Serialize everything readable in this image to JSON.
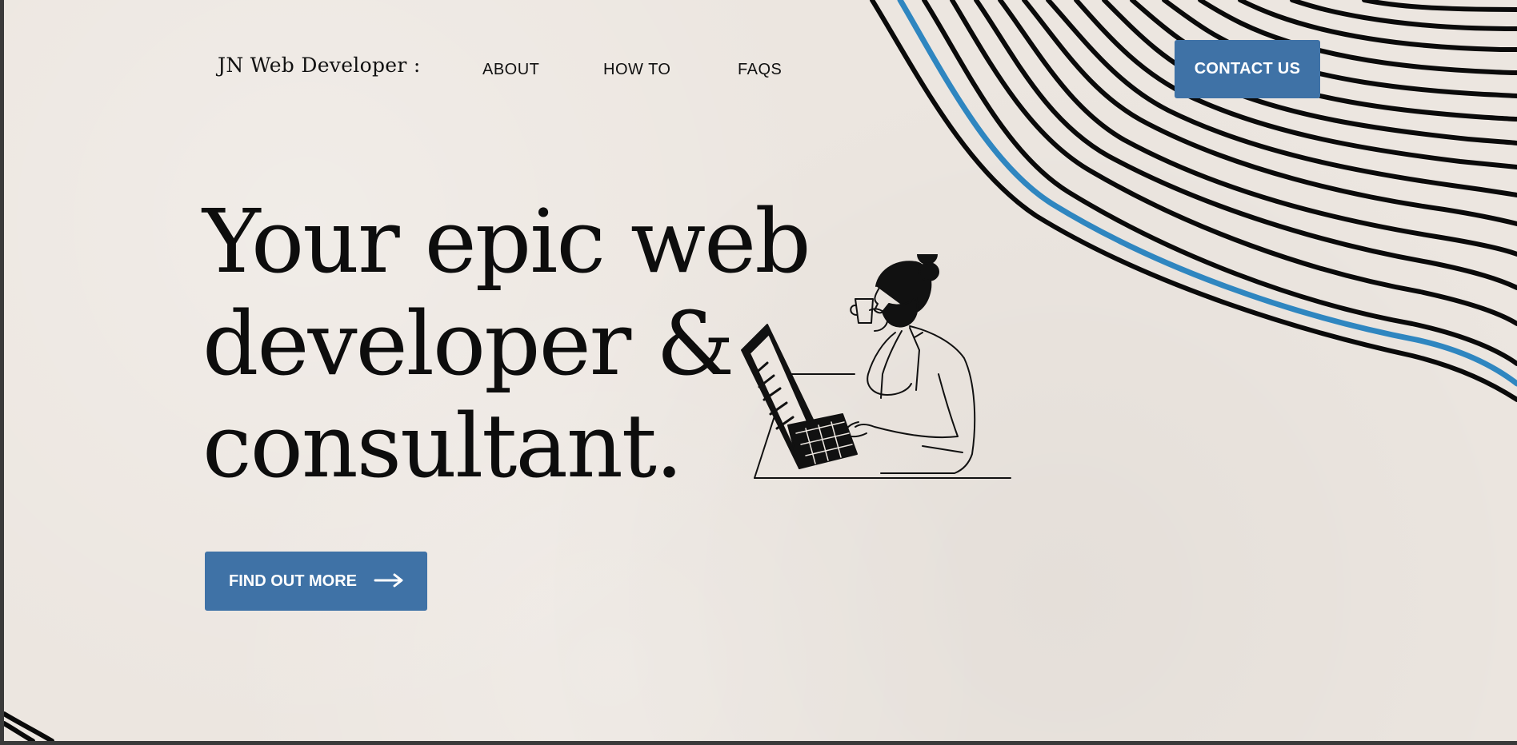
{
  "brand": {
    "logo_text": "JN Web Developer :"
  },
  "nav": {
    "items": [
      {
        "label": "ABOUT"
      },
      {
        "label": "HOW TO"
      },
      {
        "label": "FAQS"
      }
    ],
    "contact_label": "CONTACT US"
  },
  "hero": {
    "headline_lines": [
      "Your epic web",
      "developer &",
      "consultant."
    ],
    "cta_label": "FIND OUT MORE"
  },
  "colors": {
    "background": "#ece6e0",
    "accent_blue": "#3f72a6",
    "wave_blue": "#2f86c0",
    "ink": "#0d0d0d"
  },
  "icons": {
    "cta_arrow": "arrow-right-icon",
    "hero_art": "developer-illustration"
  }
}
